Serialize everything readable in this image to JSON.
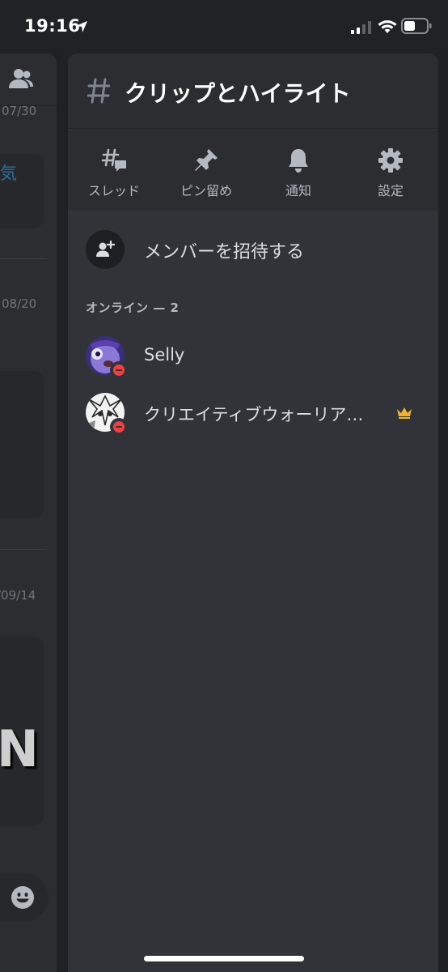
{
  "status_bar": {
    "time": "19:16"
  },
  "background_channel": {
    "dates": [
      "07/30",
      "08/20",
      "/09/14"
    ],
    "link_fragment": "気"
  },
  "drawer": {
    "title": "クリップとハイライト",
    "actions": [
      {
        "label": "スレッド",
        "icon": "threads-icon"
      },
      {
        "label": "ピン留め",
        "icon": "pin-icon"
      },
      {
        "label": "通知",
        "icon": "bell-icon"
      },
      {
        "label": "設定",
        "icon": "gear-icon"
      }
    ],
    "invite_label": "メンバーを招待する",
    "section_header": "オンライン — 2",
    "members": [
      {
        "name": "Selly",
        "status": "dnd"
      },
      {
        "name": "クリエイティブウォーリア…",
        "status": "dnd",
        "owner": true
      }
    ]
  },
  "colors": {
    "drawer_bg": "#313338",
    "header_bg": "#2b2d31",
    "dnd": "#f23f43",
    "crown": "#f0b232"
  }
}
